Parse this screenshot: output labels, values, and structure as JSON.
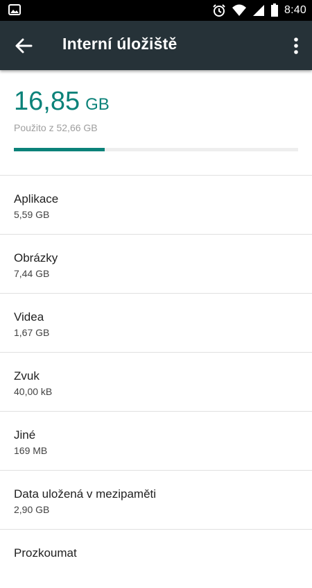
{
  "status_bar": {
    "time": "8:40",
    "icons": [
      "image-icon",
      "alarm-icon",
      "wifi-icon",
      "signal-icon",
      "battery-icon"
    ]
  },
  "app_bar": {
    "title": "Interní úložiště",
    "back_icon": "arrow-back-icon",
    "menu_icon": "more-vert-icon",
    "background": "#263238"
  },
  "summary": {
    "used_value": "16,85",
    "used_unit": "GB",
    "total_text": "Použito z 52,66 GB",
    "used_fraction": 0.32,
    "accent": "#0b8279"
  },
  "categories": [
    {
      "label": "Aplikace",
      "size": "5,59 GB"
    },
    {
      "label": "Obrázky",
      "size": "7,44 GB"
    },
    {
      "label": "Videa",
      "size": "1,67 GB"
    },
    {
      "label": "Zvuk",
      "size": "40,00 kB"
    },
    {
      "label": "Jiné",
      "size": "169 MB"
    },
    {
      "label": "Data uložená v mezipaměti",
      "size": "2,90 GB"
    },
    {
      "label": "Prozkoumat",
      "size": ""
    }
  ]
}
